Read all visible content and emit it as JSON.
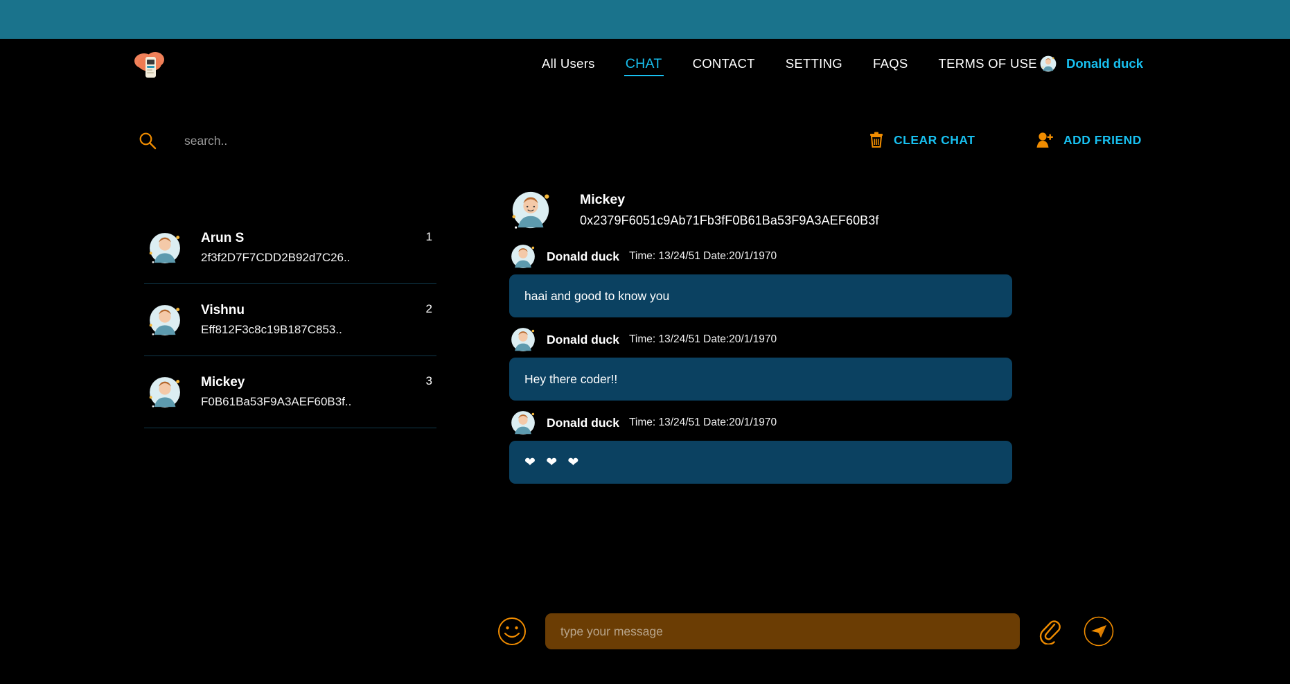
{
  "theme": {
    "top_band_color": "#1a738c",
    "page_bg": "#000000",
    "accent_cyan": "#18c0f0",
    "accent_orange": "#f08c00",
    "bubble_blue": "#0b4161",
    "input_brown": "#6b3d04"
  },
  "nav": {
    "logo_icon": "cloud-chat-logo-icon",
    "links": [
      {
        "label": "All Users",
        "active": false,
        "style": "mixedcase",
        "name": "nav-all-users"
      },
      {
        "label": "CHAT",
        "active": true,
        "style": "upper",
        "name": "nav-chat"
      },
      {
        "label": "CONTACT",
        "active": false,
        "style": "upper",
        "name": "nav-contact"
      },
      {
        "label": "SETTING",
        "active": false,
        "style": "upper",
        "name": "nav-setting"
      },
      {
        "label": "FAQS",
        "active": false,
        "style": "upper",
        "name": "nav-faqs"
      },
      {
        "label": "TERMS OF USE",
        "active": false,
        "style": "upper",
        "name": "nav-terms-of-use"
      }
    ],
    "profile": {
      "name": "Donald duck",
      "avatar_icon": "user-avatar-icon"
    }
  },
  "toolbar": {
    "search": {
      "icon": "search-icon",
      "value": "",
      "placeholder": "search.."
    },
    "clear_chat": {
      "label": "CLEAR CHAT",
      "icon": "trash-icon"
    },
    "add_friend": {
      "label": "ADD FRIEND",
      "icon": "user-plus-icon"
    }
  },
  "contacts": [
    {
      "name": "Arun S",
      "address": "2f3f2D7F7CDD2B92d7C26..",
      "count": "1",
      "avatar_icon": "user-avatar-icon"
    },
    {
      "name": "Vishnu",
      "address": "Eff812F3c8c19B187C853..",
      "count": "2",
      "avatar_icon": "user-avatar-icon"
    },
    {
      "name": "Mickey",
      "address": "F0B61Ba53F9A3AEF60B3f..",
      "count": "3",
      "avatar_icon": "user-avatar-icon"
    }
  ],
  "chat": {
    "header": {
      "name": "Mickey",
      "address": "0x2379F6051c9Ab71Fb3fF0B61Ba53F9A3AEF60B3f",
      "avatar_icon": "user-avatar-icon"
    },
    "messages": [
      {
        "sender": "Donald duck",
        "time": "Time: 13/24/51 Date:20/1/1970",
        "text": "haai and good to know you",
        "avatar_icon": "user-avatar-icon",
        "is_emoji": false
      },
      {
        "sender": "Donald duck",
        "time": "Time: 13/24/51 Date:20/1/1970",
        "text": "Hey there coder!!",
        "avatar_icon": "user-avatar-icon",
        "is_emoji": false
      },
      {
        "sender": "Donald duck",
        "time": "Time: 13/24/51 Date:20/1/1970",
        "text": "❤ ❤ ❤",
        "avatar_icon": "user-avatar-icon",
        "is_emoji": true
      }
    ]
  },
  "composer": {
    "emoji_icon": "smiley-face-icon",
    "input_value": "",
    "input_placeholder": "type your message",
    "attach_icon": "paperclip-icon",
    "send_icon": "send-paper-plane-icon"
  }
}
